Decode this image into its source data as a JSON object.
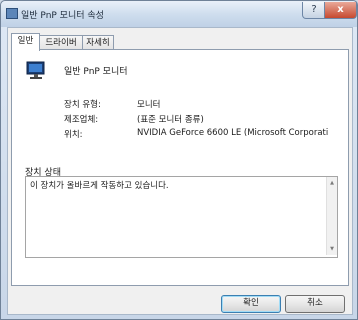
{
  "window": {
    "title": "일반 PnP 모니터 속성",
    "help_label": "?",
    "close_label": "x"
  },
  "tabs": [
    {
      "label": "일반"
    },
    {
      "label": "드라이버"
    },
    {
      "label": "자세히"
    }
  ],
  "device": {
    "name": "일반 PnP 모니터",
    "icon": "monitor-icon"
  },
  "properties": [
    {
      "label": "장치 유형:",
      "value": "모니터"
    },
    {
      "label": "제조업체:",
      "value": "(표준 모니터 종류)"
    },
    {
      "label": "위치:",
      "value": "NVIDIA GeForce 6600 LE (Microsoft Corporati"
    }
  ],
  "status": {
    "label": "장치 상태",
    "text": "이 장치가 올바르게 작동하고 있습니다."
  },
  "buttons": {
    "ok": "확인",
    "cancel": "취소"
  }
}
